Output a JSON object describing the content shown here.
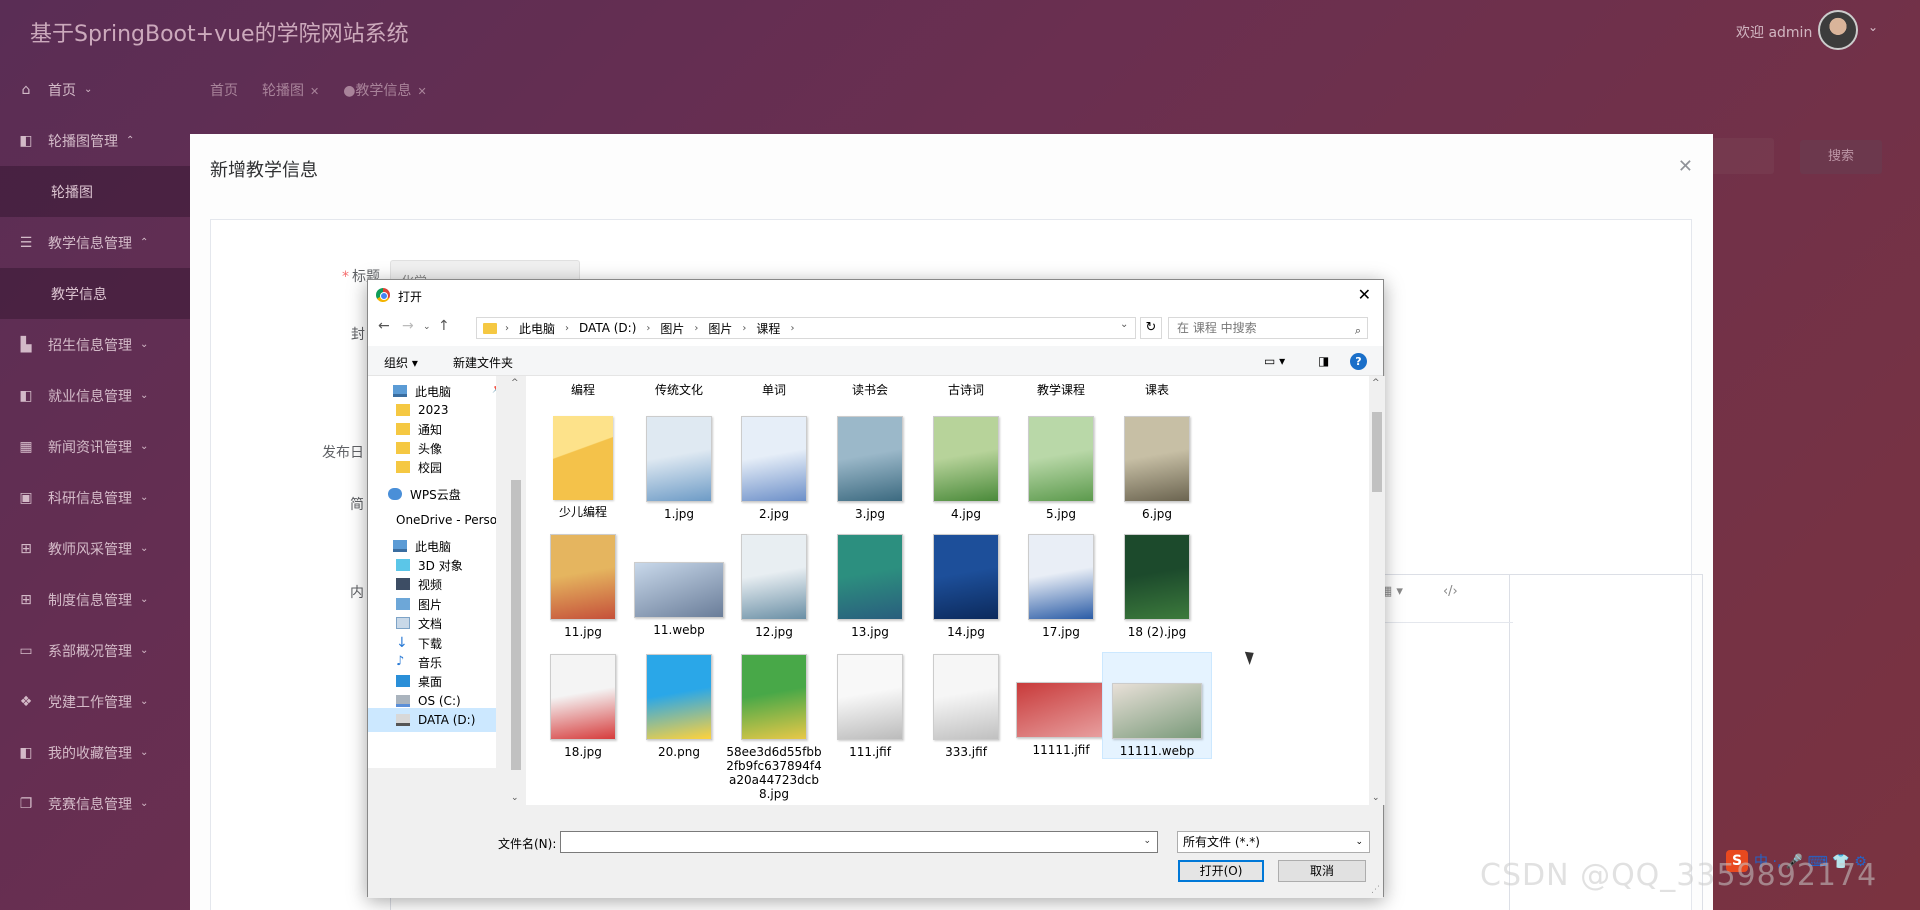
{
  "header": {
    "title": "基于SpringBoot+vue的学院网站系统",
    "welcome": "欢迎 admin"
  },
  "sidebar": {
    "items": [
      {
        "label": "首页",
        "icon": "home-icon",
        "caret": "⌄"
      },
      {
        "label": "轮播图管理",
        "icon": "sidebar-panel-icon",
        "caret": "⌃"
      },
      {
        "label": "轮播图",
        "sub": true
      },
      {
        "label": "教学信息管理",
        "icon": "storage-icon",
        "caret": "⌃"
      },
      {
        "label": "教学信息",
        "sub": true
      },
      {
        "label": "招生信息管理",
        "icon": "building-icon",
        "caret": "⌄"
      },
      {
        "label": "就业信息管理",
        "icon": "sidebar-panel-icon",
        "caret": "⌄"
      },
      {
        "label": "新闻资讯管理",
        "icon": "grid-icon",
        "caret": "⌄"
      },
      {
        "label": "科研信息管理",
        "icon": "briefcase-icon",
        "caret": "⌄"
      },
      {
        "label": "教师风采管理",
        "icon": "chip-icon",
        "caret": "⌄"
      },
      {
        "label": "制度信息管理",
        "icon": "chip-icon",
        "caret": "⌄"
      },
      {
        "label": "系部概况管理",
        "icon": "ticket-icon",
        "caret": "⌄"
      },
      {
        "label": "党建工作管理",
        "icon": "apps-icon",
        "caret": "⌄"
      },
      {
        "label": "我的收藏管理",
        "icon": "sidebar-panel-icon",
        "caret": "⌄"
      },
      {
        "label": "竞赛信息管理",
        "icon": "copy-icon",
        "caret": "⌄"
      }
    ]
  },
  "tabs": [
    {
      "label": "首页",
      "closable": false
    },
    {
      "label": "轮播图",
      "closable": true
    },
    {
      "label": "●教学信息",
      "closable": true
    }
  ],
  "toolbar": {
    "search_label": "搜索"
  },
  "modal": {
    "title": "新增教学信息",
    "fields": {
      "title_label": "标题",
      "title_value": "化学",
      "cover_label": "封",
      "date_label": "发布日",
      "summary_label": "简",
      "content_label": "内"
    }
  },
  "file_dialog": {
    "title": "打开",
    "breadcrumb": [
      "此电脑",
      "DATA (D:)",
      "图片",
      "图片",
      "课程"
    ],
    "search_placeholder": "在 课程 中搜索",
    "organize_label": "组织 ▾",
    "new_folder_label": "新建文件夹",
    "tree": [
      {
        "label": "此电脑",
        "icon": "pc",
        "pinned": true
      },
      {
        "label": "2023",
        "icon": "folder"
      },
      {
        "label": "通知",
        "icon": "folder"
      },
      {
        "label": "头像",
        "icon": "folder"
      },
      {
        "label": "校园",
        "icon": "folder"
      },
      {
        "label": "WPS云盘",
        "icon": "cloud"
      },
      {
        "label": "OneDrive - Perso",
        "icon": "cloud"
      },
      {
        "label": "此电脑",
        "icon": "pc"
      },
      {
        "label": "3D 对象",
        "icon": "cube"
      },
      {
        "label": "视频",
        "icon": "video"
      },
      {
        "label": "图片",
        "icon": "pic"
      },
      {
        "label": "文档",
        "icon": "doc"
      },
      {
        "label": "下载",
        "icon": "down"
      },
      {
        "label": "音乐",
        "icon": "music"
      },
      {
        "label": "桌面",
        "icon": "desk"
      },
      {
        "label": "OS (C:)",
        "icon": "drive"
      },
      {
        "label": "DATA (D:)",
        "icon": "drive2",
        "selected": true
      }
    ],
    "top_row": [
      "编程",
      "传统文化",
      "单词",
      "读书会",
      "古诗词",
      "教学课程",
      "课表"
    ],
    "files": [
      {
        "name": "少儿编程",
        "kind": "folder"
      },
      {
        "name": "1.jpg",
        "colors": [
          "#dfe9f2",
          "#6d9bc6"
        ]
      },
      {
        "name": "2.jpg",
        "colors": [
          "#e6eef8",
          "#6c8fc8"
        ]
      },
      {
        "name": "3.jpg",
        "colors": [
          "#9bb8c9",
          "#3c6a80"
        ]
      },
      {
        "name": "4.jpg",
        "colors": [
          "#b7d39a",
          "#4a8a3a"
        ]
      },
      {
        "name": "5.jpg",
        "colors": [
          "#b9d8a8",
          "#5c9a4d"
        ]
      },
      {
        "name": "6.jpg",
        "colors": [
          "#c7bfa5",
          "#6b6450"
        ]
      },
      {
        "name": "11.jpg",
        "colors": [
          "#e5b55f",
          "#c5503a"
        ]
      },
      {
        "name": "11.webp",
        "kind": "wide",
        "colors": [
          "#c8d8ea",
          "#6a7d99"
        ]
      },
      {
        "name": "12.jpg",
        "colors": [
          "#e8eef2",
          "#6a8fa5"
        ]
      },
      {
        "name": "13.jpg",
        "colors": [
          "#2c8f7f",
          "#2a5e7d"
        ]
      },
      {
        "name": "14.jpg",
        "colors": [
          "#1d4f9a",
          "#0c2a5c"
        ]
      },
      {
        "name": "17.jpg",
        "colors": [
          "#e9eef6",
          "#2b5ca6"
        ]
      },
      {
        "name": "18 (2).jpg",
        "colors": [
          "#1c4a2c",
          "#3c7a3c"
        ]
      },
      {
        "name": "18.jpg",
        "colors": [
          "#f4f4f4",
          "#d63c3c"
        ]
      },
      {
        "name": "20.png",
        "colors": [
          "#2aa7e8",
          "#ffd23c"
        ]
      },
      {
        "name": "58ee3d6d55fbb2fb9fc637894f4a20a44723dcb8.jpg",
        "colors": [
          "#48a848",
          "#e8c848"
        ]
      },
      {
        "name": "111.jfif",
        "colors": [
          "#f8f8f8",
          "#bbbbbb"
        ]
      },
      {
        "name": "333.jfif",
        "colors": [
          "#f6f6f6",
          "#c0c0c0"
        ]
      },
      {
        "name": "11111.jfif",
        "kind": "wide",
        "colors": [
          "#c83a3a",
          "#e8a0a0"
        ]
      },
      {
        "name": "11111.webp",
        "kind": "wide",
        "selected": true,
        "colors": [
          "#e8e0d8",
          "#7a9a7a"
        ]
      }
    ],
    "filename_label": "文件名(N):",
    "filename_value": "",
    "filetype": "所有文件 (*.*)",
    "open_label": "打开(O)",
    "cancel_label": "取消"
  },
  "watermark": "CSDN @QQ_3359892174",
  "ime": {
    "logo": "S",
    "text": "中 ·, 🎤 ⌨ 👕 ⚙"
  }
}
